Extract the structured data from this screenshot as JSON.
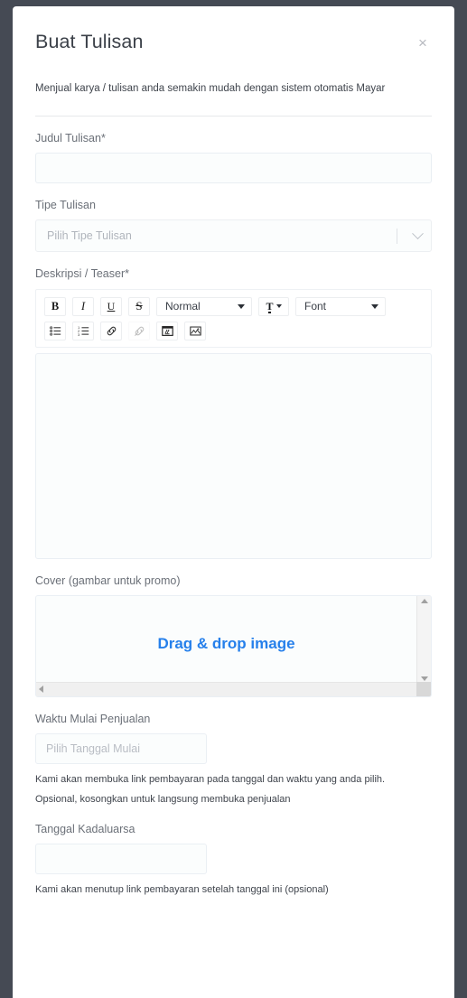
{
  "modal": {
    "title": "Buat Tulisan",
    "close_label": "×",
    "subtitle": "Menjual karya / tulisan anda semakin mudah dengan sistem otomatis Mayar"
  },
  "colors": {
    "backdrop": "#454a54",
    "accent_blue": "#2680eb",
    "label": "#6b7078",
    "title": "#3c4149"
  },
  "fields": {
    "judul": {
      "label": "Judul Tulisan*",
      "value": "",
      "placeholder": ""
    },
    "tipe": {
      "label": "Tipe Tulisan",
      "selected": "Pilih Tipe Tulisan"
    },
    "deskripsi": {
      "label": "Deskripsi / Teaser*",
      "content": ""
    },
    "cover": {
      "label": "Cover (gambar untuk promo)",
      "dropzone_text": "Drag & drop image"
    },
    "waktu_mulai": {
      "label": "Waktu Mulai Penjualan",
      "value": "",
      "placeholder": "Pilih Tanggal Mulai",
      "help_line_1": "Kami akan membuka link pembayaran pada tanggal dan waktu yang anda pilih.",
      "help_line_2": "Opsional, kosongkan untuk langsung membuka penjualan"
    },
    "tanggal_kadaluarsa": {
      "label": "Tanggal Kadaluarsa",
      "value": "",
      "placeholder": "",
      "help_line_1": "Kami akan menutup link pembayaran setelah tanggal ini (opsional)"
    }
  },
  "editor_toolbar": {
    "bold": "B",
    "italic": "I",
    "underline": "U",
    "strike": "S",
    "heading_select": "Normal",
    "font_select": "Font",
    "color_letter": "T"
  }
}
